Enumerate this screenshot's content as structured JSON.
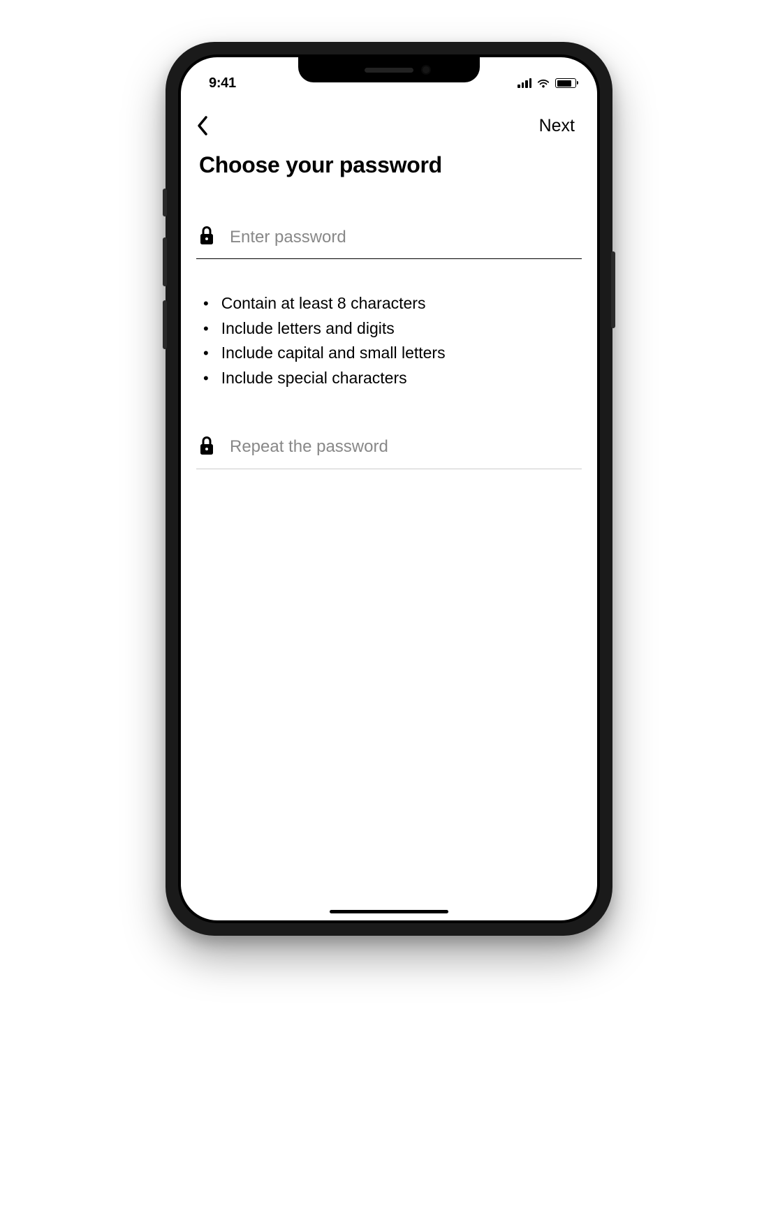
{
  "statusBar": {
    "time": "9:41"
  },
  "nav": {
    "nextLabel": "Next"
  },
  "page": {
    "title": "Choose your password"
  },
  "passwordField": {
    "placeholder": "Enter password",
    "value": ""
  },
  "repeatField": {
    "placeholder": "Repeat the password",
    "value": ""
  },
  "requirements": [
    "Contain at least 8 characters",
    "Include letters and digits",
    "Include capital and small letters",
    "Include special characters"
  ]
}
